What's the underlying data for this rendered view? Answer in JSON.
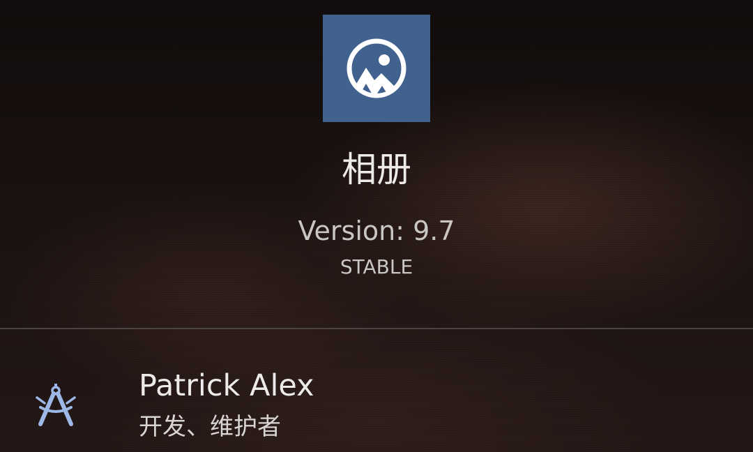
{
  "app": {
    "name": "相册",
    "version": "Version: 9.7",
    "channel": "STABLE",
    "icon": "gallery-mountains-icon",
    "icon_color": "#41618f"
  },
  "developer": {
    "name": "Patrick Alex",
    "role": "开发、维护者",
    "icon": "compass-drafting-icon",
    "icon_color": "#9db8e6"
  },
  "colors": {
    "primary_text": "#ecebea",
    "secondary_text": "#c9c6c4",
    "divider": "#4b4341"
  }
}
